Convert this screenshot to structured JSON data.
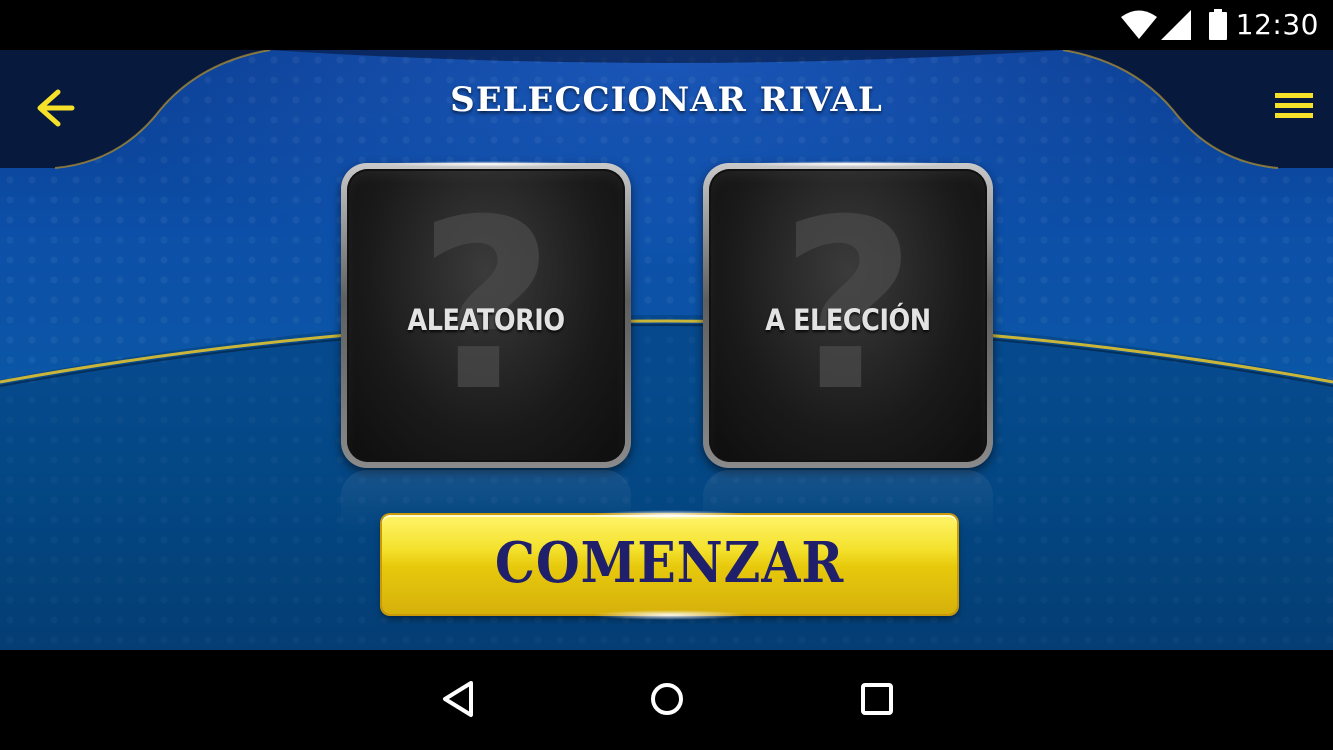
{
  "status_bar": {
    "time": "12:30",
    "icons": [
      "wifi-icon",
      "signal-icon",
      "battery-icon"
    ]
  },
  "header": {
    "title": "SELECCIONAR RIVAL",
    "back_icon": "arrow-left-icon",
    "menu_icon": "hamburger-menu-icon"
  },
  "options": [
    {
      "label": "ALEATORIO",
      "icon": "question-mark-icon",
      "glyph": "?"
    },
    {
      "label": "A ELECCIÓN",
      "icon": "question-mark-icon",
      "glyph": "?"
    }
  ],
  "start_button": {
    "label": "COMENZAR"
  },
  "nav_bar": {
    "icons": [
      "nav-back-icon",
      "nav-home-icon",
      "nav-recents-icon"
    ]
  },
  "colors": {
    "accent_yellow": "#f5e02a",
    "button_text": "#1f1f6b",
    "background_blue": "#0c4fa8"
  }
}
